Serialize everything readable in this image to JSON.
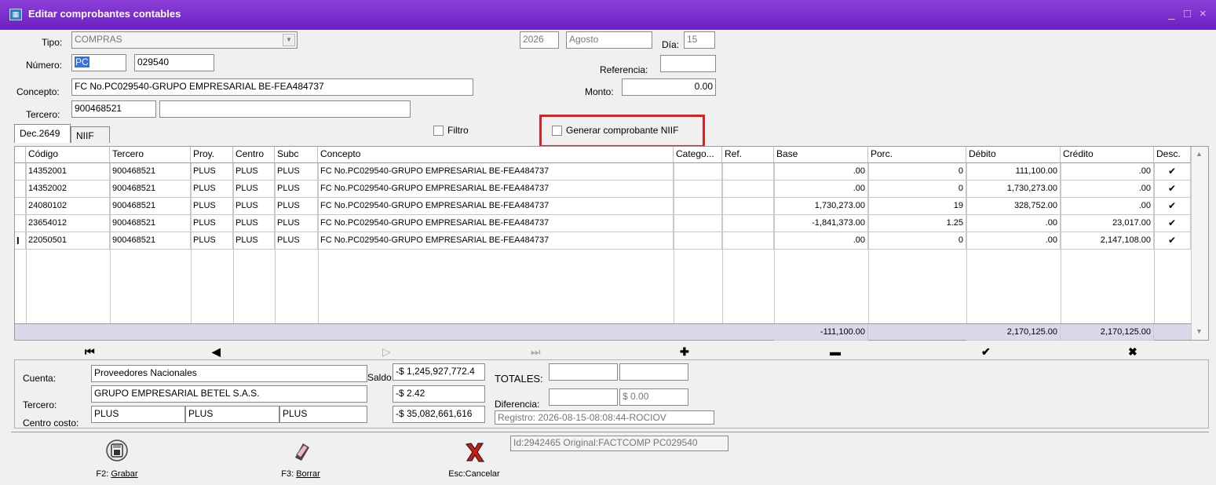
{
  "window": {
    "title": "Editar comprobantes contables",
    "controls": [
      "_",
      "□",
      "×"
    ],
    "icon": "app-icon"
  },
  "form": {
    "tipo_label": "Tipo:",
    "tipo_value": "COMPRAS",
    "year": "2026",
    "month": "Agosto",
    "dia_label": "Día:",
    "dia_value": "15",
    "numero_label": "Número:",
    "numero_prefix": "PC",
    "numero_value": "029540",
    "referencia_label": "Referencia:",
    "referencia_value": "",
    "concepto_label": "Concepto:",
    "concepto_value": "FC No.PC029540-GRUPO EMPRESARIAL BE-FEA484737",
    "monto_label": "Monto:",
    "monto_value": "0.00",
    "tercero_label": "Tercero:",
    "tercero_value": "900468521",
    "tercero_name": ""
  },
  "tabs": [
    {
      "label": "Dec.2649"
    },
    {
      "label": "NIIF"
    }
  ],
  "filtro_label": "Filtro",
  "generar_label": "Generar comprobante NIIF",
  "grid": {
    "headers": [
      "Código",
      "Tercero",
      "Proy.",
      "Centro",
      "Subc",
      "Concepto",
      "Catego...",
      "Ref.",
      "Base",
      "Porc.",
      "Débito",
      "Crédito",
      "Desc."
    ],
    "rows": [
      {
        "codigo": "14352001",
        "tercero": "900468521",
        "proy": "PLUS",
        "centro": "PLUS",
        "subc": "PLUS",
        "concepto": "FC No.PC029540-GRUPO EMPRESARIAL BE-FEA484737",
        "base": ".00",
        "porc": "0",
        "debito": "111,100.00",
        "credito": ".00",
        "desc": "✔"
      },
      {
        "codigo": "14352002",
        "tercero": "900468521",
        "proy": "PLUS",
        "centro": "PLUS",
        "subc": "PLUS",
        "concepto": "FC No.PC029540-GRUPO EMPRESARIAL BE-FEA484737",
        "base": ".00",
        "porc": "0",
        "debito": "1,730,273.00",
        "credito": ".00",
        "desc": "✔"
      },
      {
        "codigo": "24080102",
        "tercero": "900468521",
        "proy": "PLUS",
        "centro": "PLUS",
        "subc": "PLUS",
        "concepto": "FC No.PC029540-GRUPO EMPRESARIAL BE-FEA484737",
        "base": "1,730,273.00",
        "porc": "19",
        "debito": "328,752.00",
        "credito": ".00",
        "desc": "✔"
      },
      {
        "codigo": "23654012",
        "tercero": "900468521",
        "proy": "PLUS",
        "centro": "PLUS",
        "subc": "PLUS",
        "concepto": "FC No.PC029540-GRUPO EMPRESARIAL BE-FEA484737",
        "base": "-1,841,373.00",
        "porc": "1.25",
        "debito": ".00",
        "credito": "23,017.00",
        "desc": "✔"
      },
      {
        "codigo": "22050501",
        "tercero": "900468521",
        "proy": "PLUS",
        "centro": "PLUS",
        "subc": "PLUS",
        "concepto": "FC No.PC029540-GRUPO EMPRESARIAL BE-FEA484737",
        "base": ".00",
        "porc": "0",
        "debito": ".00",
        "credito": "2,147,108.00",
        "desc": "✔"
      }
    ],
    "totals": {
      "base": "-111,100.00",
      "debito": "2,170,125.00",
      "credito": "2,170,125.00"
    }
  },
  "nav": {
    "first": "⏮",
    "prev": "◀",
    "next": "▷",
    "last": "⏭",
    "add": "✚",
    "remove": "▬",
    "confirm": "✔",
    "cancel": "✖"
  },
  "info": {
    "cuenta_label": "Cuenta:",
    "cuenta_value": "Proveedores Nacionales",
    "saldo_label": "Saldo:",
    "saldo_value": "-$ 1,245,927,772.4",
    "tercero_label": "Tercero:",
    "tercero_value": "GRUPO EMPRESARIAL BETEL S.A.S.",
    "tercero_saldo": "-$ 2.42",
    "centro_label": "Centro costo:",
    "centro_values": [
      "PLUS",
      "PLUS",
      "PLUS"
    ],
    "centro_saldo": "-$ 35,082,661,616",
    "totales_label": "TOTALES:",
    "diferencia_label": "Diferencia:",
    "diferencia_value": "$ 0.00",
    "registro": "Registro: 2026-08-15-08:08:44-ROCIOV"
  },
  "toolbar": {
    "grabar_key": "F2: ",
    "grabar_label": "Grabar",
    "borrar_key": "F3: ",
    "borrar_label": "Borrar",
    "cancelar_label": "Esc:Cancelar",
    "id_text": "Id:2942465 Original:FACTCOMP PC029540"
  }
}
